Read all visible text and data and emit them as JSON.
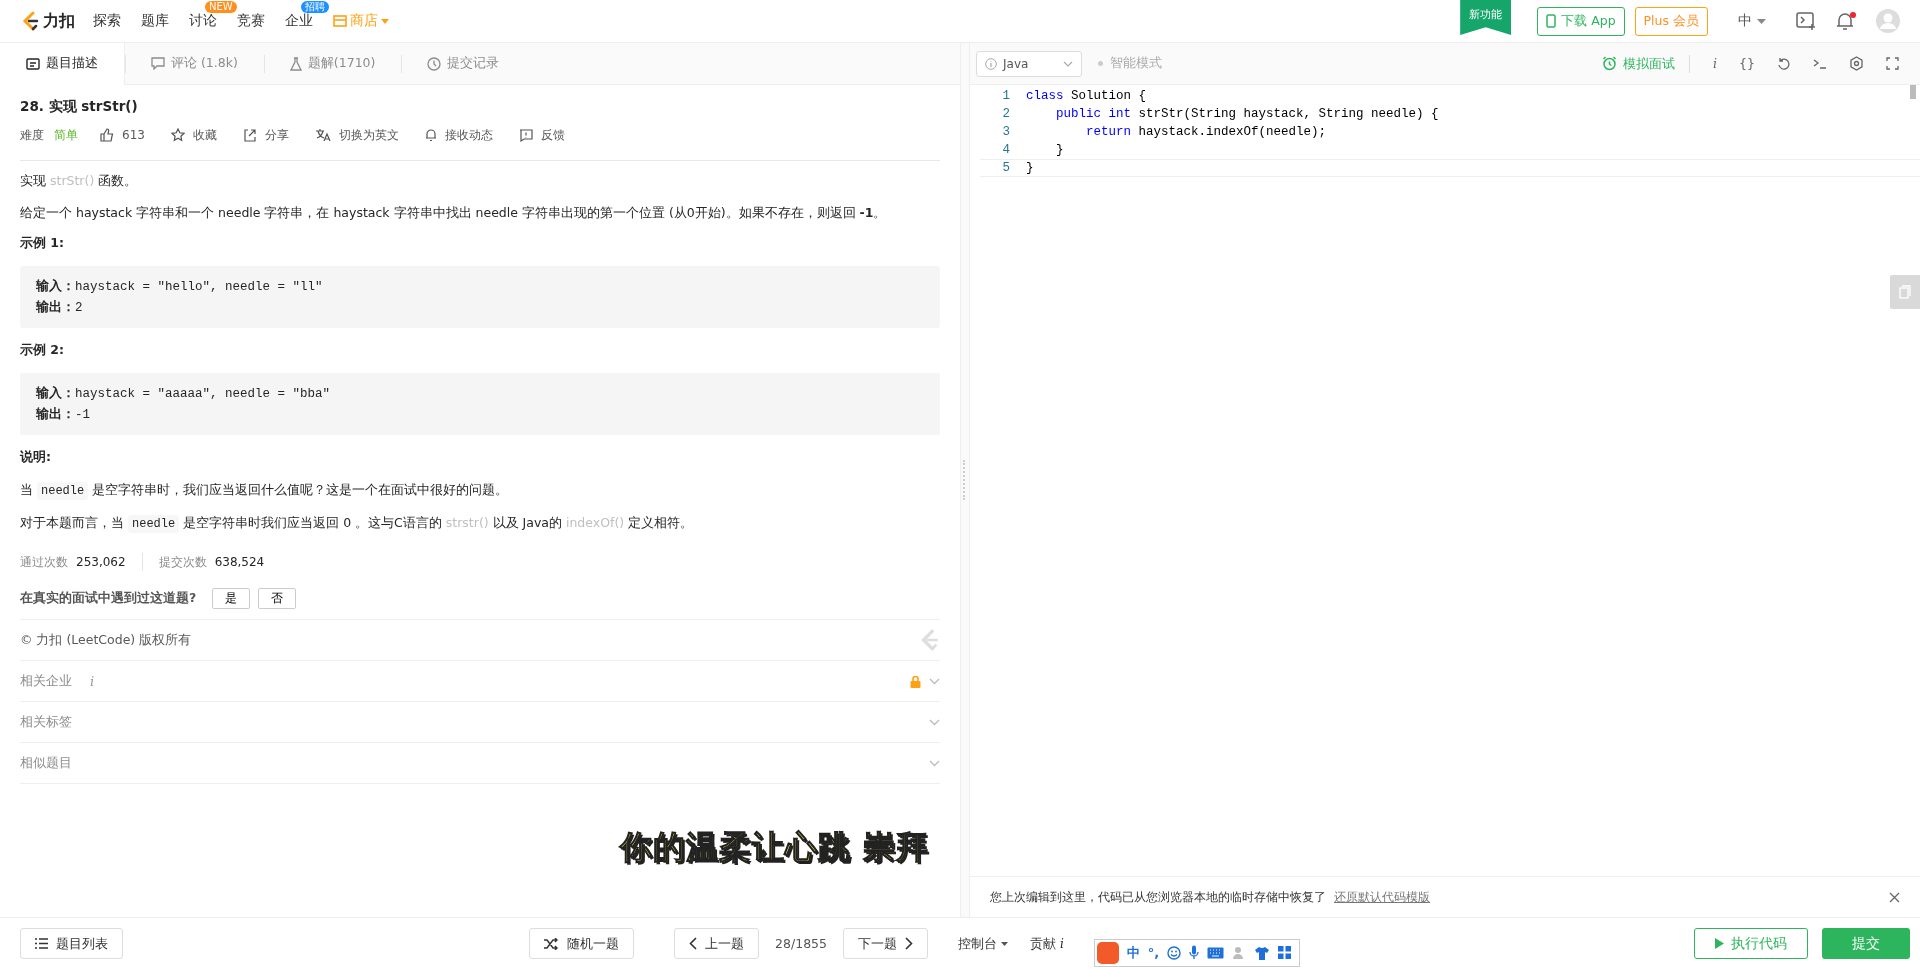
{
  "nav": {
    "logo": "力扣",
    "items": [
      {
        "label": "探索",
        "kind": "plain"
      },
      {
        "label": "题库",
        "kind": "plain"
      },
      {
        "label": "讨论",
        "kind": "badge",
        "badge": "NEW",
        "color": "#ff8f1f"
      },
      {
        "label": "竞赛",
        "kind": "plain"
      },
      {
        "label": "企业",
        "kind": "badge",
        "badge": "招聘",
        "color": "#1e90ff"
      },
      {
        "label": "商店",
        "kind": "store"
      }
    ],
    "ribbon": "新功能",
    "download": "下载 App",
    "plus": "Plus 会员",
    "lang": "中",
    "notification_dot": true
  },
  "tabs": [
    {
      "label": "题目描述",
      "kind": "desc",
      "selected": true
    },
    {
      "label": "评论 (1.8k)",
      "kind": "comment",
      "selected": false
    },
    {
      "label": "题解(1710)",
      "kind": "flask",
      "selected": false
    },
    {
      "label": "提交记录",
      "kind": "clock",
      "selected": false
    }
  ],
  "problem": {
    "title": "28. 实现 strStr()",
    "difficulty_label": "难度",
    "difficulty": "简单",
    "likes": "613",
    "actions": [
      {
        "label": "收藏",
        "kind": "star"
      },
      {
        "label": "分享",
        "kind": "share"
      },
      {
        "label": "切换为英文",
        "kind": "translate"
      },
      {
        "label": "接收动态",
        "kind": "bell"
      },
      {
        "label": "反馈",
        "kind": "feedback"
      }
    ],
    "blocks": [
      {
        "kind": "para",
        "parts": [
          {
            "kind": "text",
            "text": "实现 "
          },
          {
            "kind": "fn",
            "text": "strStr()"
          },
          {
            "kind": "text",
            "text": " 函数。"
          }
        ]
      },
      {
        "kind": "para",
        "parts": [
          {
            "kind": "text",
            "text": "给定一个 haystack 字符串和一个 needle 字符串，在 haystack 字符串中找出 needle 字符串出现的第一个位置 (从0开始)。如果不存在，则返回 "
          },
          {
            "kind": "bold",
            "text": " -1"
          },
          {
            "kind": "text",
            "text": "。"
          }
        ]
      },
      {
        "kind": "heading",
        "text": "示例 1:"
      },
      {
        "kind": "example",
        "lines": [
          {
            "label": "输入：",
            "value": "haystack = \"hello\", needle = \"ll\""
          },
          {
            "label": "输出：",
            "value": "2"
          }
        ]
      },
      {
        "kind": "heading",
        "text": "示例 2:"
      },
      {
        "kind": "example",
        "lines": [
          {
            "label": "输入：",
            "value": "haystack = \"aaaaa\", needle = \"bba\""
          },
          {
            "label": "输出：",
            "value": "-1"
          }
        ]
      },
      {
        "kind": "heading",
        "text": "说明:"
      },
      {
        "kind": "para",
        "parts": [
          {
            "kind": "text",
            "text": "当 "
          },
          {
            "kind": "code",
            "text": "needle"
          },
          {
            "kind": "text",
            "text": " 是空字符串时，我们应当返回什么值呢？这是一个在面试中很好的问题。"
          }
        ]
      },
      {
        "kind": "para",
        "parts": [
          {
            "kind": "text",
            "text": "对于本题而言，当 "
          },
          {
            "kind": "code",
            "text": "needle"
          },
          {
            "kind": "text",
            "text": " 是空字符串时我们应当返回 0 。这与C语言的 "
          },
          {
            "kind": "fn",
            "text": "strstr()"
          },
          {
            "kind": "text",
            "text": " 以及 Java的 "
          },
          {
            "kind": "fn",
            "text": "indexOf()"
          },
          {
            "kind": "text",
            "text": " 定义相符。"
          }
        ]
      }
    ],
    "stats": [
      {
        "label": "通过次数",
        "value": "253,062"
      },
      {
        "label": "提交次数",
        "value": "638,524"
      }
    ],
    "question": "在真实的面试中遇到过这道题?",
    "answers": [
      "是",
      "否"
    ],
    "copyright": "© 力扣 (LeetCode) 版权所有",
    "sections": [
      {
        "label": "相关企业",
        "info": "i",
        "locked": true
      },
      {
        "label": "相关标签",
        "locked": false
      },
      {
        "label": "相似题目",
        "locked": false
      }
    ]
  },
  "editor": {
    "language": "Java",
    "smart_mode": "智能模式",
    "mock": "模拟面试",
    "info": "i",
    "braces": "{}",
    "lines": [
      {
        "number": "1",
        "tokens": [
          {
            "kind": "kw",
            "text": "class"
          },
          {
            "kind": "plain",
            "text": " Solution {"
          }
        ],
        "children": [
          {
            "number": "2",
            "tokens": [
              {
                "kind": "kw",
                "text": "public "
              },
              {
                "kind": "kw",
                "text": "int"
              },
              {
                "kind": "plain",
                "text": " strStr(String haystack, String needle) {"
              }
            ],
            "children": [
              {
                "number": "3",
                "tokens": [
                  {
                    "kind": "kw",
                    "text": "return"
                  },
                  {
                    "kind": "plain",
                    "text": " haystack.indexOf(needle);"
                  }
                ]
              }
            ]
          },
          {
            "number": "4",
            "tokens": [
              {
                "kind": "plain",
                "text": "}"
              }
            ]
          }
        ]
      },
      {
        "number": "5",
        "tokens": [
          {
            "kind": "plain",
            "text": "}"
          }
        ]
      }
    ],
    "notice": "您上次编辑到这里，代码已从您浏览器本地的临时存储中恢复了",
    "notice_link": "还原默认代码模版"
  },
  "caption": "你的温柔让心跳 崇拜",
  "bottom": {
    "list": "题目列表",
    "random": "随机一题",
    "prev": "上一题",
    "page": "28/1855",
    "next": "下一题",
    "console": "控制台",
    "contribute": "贡献",
    "contribute_info": "i",
    "run": "执行代码",
    "submit": "提交"
  },
  "ime": {
    "mode": "中",
    "punct": "°,"
  }
}
